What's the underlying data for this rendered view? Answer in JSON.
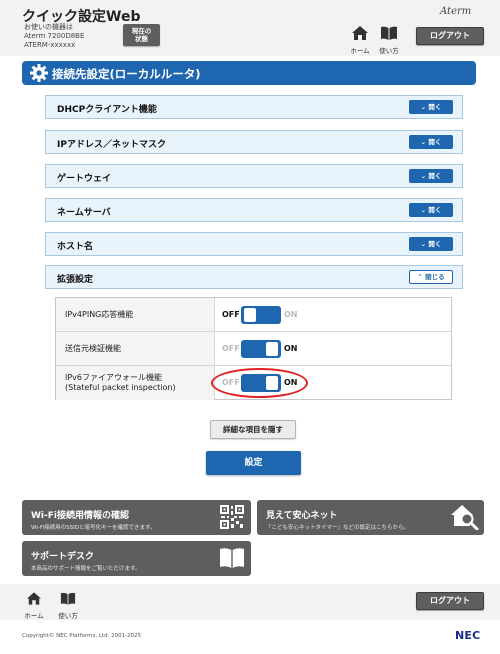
{
  "header": {
    "app_title": "クイック設定Web",
    "device_info": [
      "お使いの機器は",
      "Aterm 7200D8BE",
      "ATERM-xxxxxx"
    ],
    "status_button": [
      "現在の",
      "状態"
    ],
    "brand": "Aterm",
    "nav_home": "ホーム",
    "nav_help": "使い方",
    "logout": "ログアウト"
  },
  "page": {
    "title": "接続先設定(ローカルルータ)"
  },
  "accordions": [
    {
      "label": "DHCPクライアント機能",
      "button": "開く"
    },
    {
      "label": "IPアドレス／ネットマスク",
      "button": "開く"
    },
    {
      "label": "ゲートウェイ",
      "button": "開く"
    },
    {
      "label": "ネームサーバ",
      "button": "開く"
    },
    {
      "label": "ホスト名",
      "button": "開く"
    },
    {
      "label": "拡張設定",
      "button": "閉じる"
    }
  ],
  "settings": [
    {
      "label": "IPv4PING応答機能",
      "off": "OFF",
      "on": "ON",
      "state": "OFF"
    },
    {
      "label": "送信元検証機能",
      "off": "OFF",
      "on": "ON",
      "state": "ON"
    },
    {
      "label_line1": "IPv6ファイアウォール機能",
      "label_line2": "(Stateful packet inspection)",
      "off": "OFF",
      "on": "ON",
      "state": "ON"
    }
  ],
  "buttons": {
    "hide_details": "詳細な項目を隠す",
    "submit": "設定"
  },
  "cards": {
    "wifi_title": "Wi-Fi接続用情報の確認",
    "wifi_desc": "Wi-Fi接続用のSSIDと暗号化キーを確認できます。",
    "safety_title": "見えて安心ネット",
    "safety_desc": "「こども安心ネットタイマー」などの設定はこちらから。",
    "support_title": "サポートデスク",
    "support_desc": "本商品のサポート情報をご覧いただけます。"
  },
  "footer": {
    "home": "ホーム",
    "help": "使い方",
    "logout": "ログアウト",
    "copyright": "Copyright© NEC Platforms, Ltd. 2001-2025",
    "logo": "NEC"
  },
  "colors": {
    "accent": "#1f66b0",
    "card_bg": "#5e5e5e",
    "highlight": "#e02020"
  }
}
